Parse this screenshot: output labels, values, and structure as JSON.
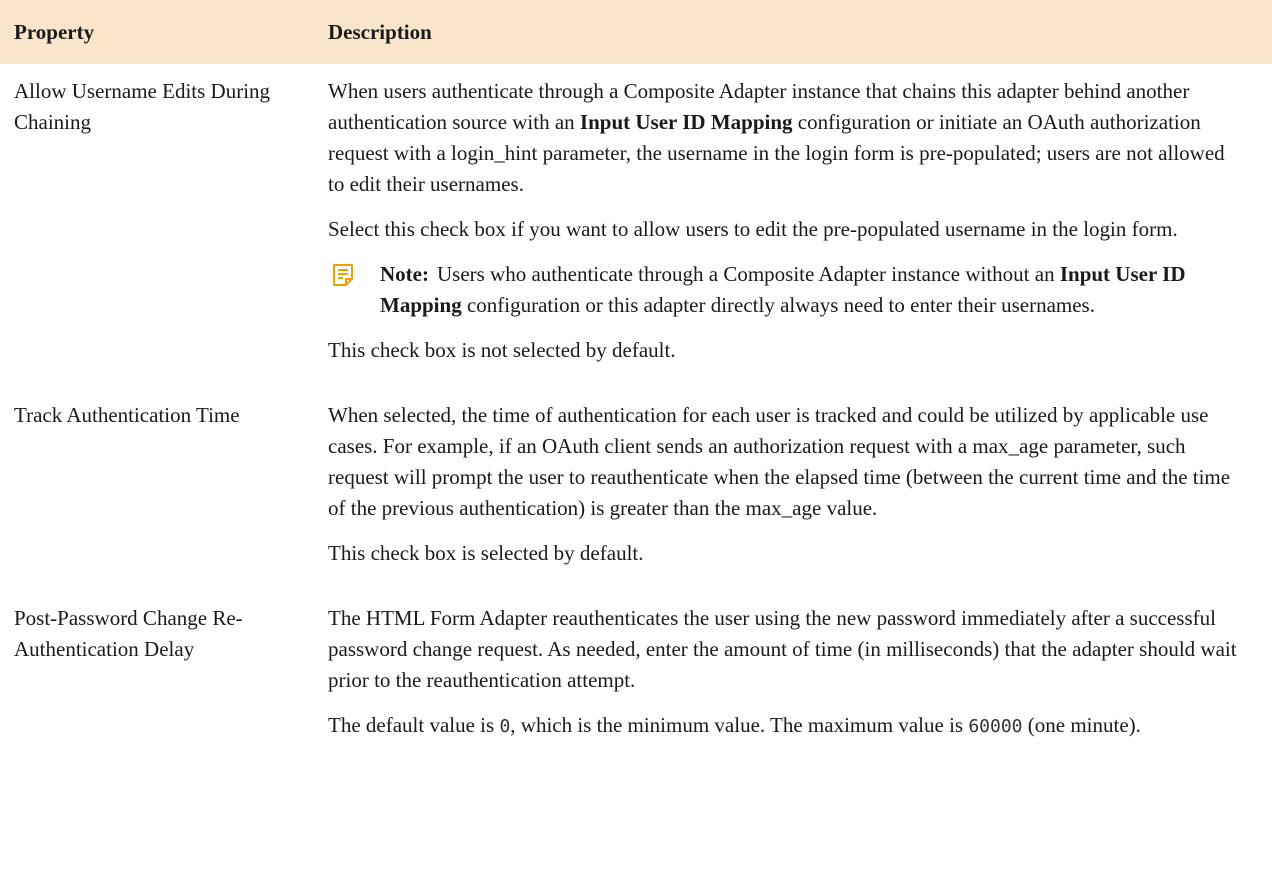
{
  "header": {
    "property_label": "Property",
    "description_label": "Description"
  },
  "rows": [
    {
      "property": "Allow Username Edits During Chaining",
      "p1": {
        "a": "When users authenticate through a Composite Adapter instance that chains this adapter behind another authentication source with an ",
        "b": "Input User ID Mapping",
        "c": " configuration or initiate an OAuth authorization request with a login_hint parameter, the username in the login form is pre-populated; users are not allowed to edit their usernames."
      },
      "p2": "Select this check box if you want to allow users to edit the pre-populated username in the login form.",
      "note": {
        "icon": "note-icon",
        "label": "Note:",
        "a": "Users who authenticate through a Composite Adapter instance without an ",
        "b": "Input User ID Mapping",
        "c": " configuration or this adapter directly always need to enter their usernames."
      },
      "p3": "This check box is not selected by default."
    },
    {
      "property": "Track Authentication Time",
      "p1": "When selected, the time of authentication for each user is tracked and could be utilized by applicable use cases. For example, if an OAuth client sends an authorization request with a max_age parameter, such request will prompt the user to reauthenticate when the elapsed time (between the current time and the time of the previous authentication) is greater than the max_age value.",
      "p2": "This check box is selected by default."
    },
    {
      "property": "Post-Password Change Re-Authentication Delay",
      "p1": "The HTML Form Adapter reauthenticates the user using the new password immediately after a successful password change request. As needed, enter the amount of time (in milliseconds) that the adapter should wait prior to the reauthentication attempt.",
      "p2": {
        "a": "The default value is ",
        "b": "0",
        "c": ", which is the minimum value. The maximum value is ",
        "d": "60000",
        "e": " (one minute)."
      }
    }
  ]
}
